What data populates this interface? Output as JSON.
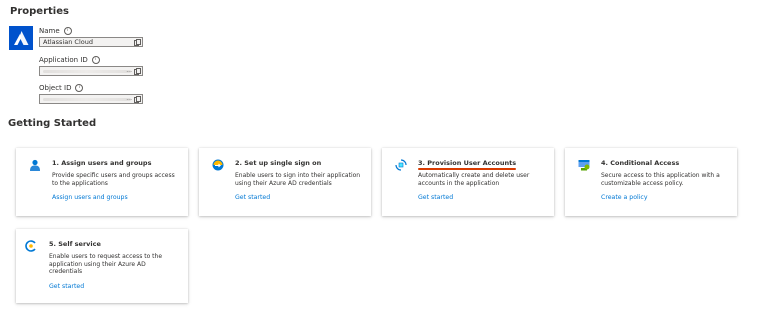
{
  "properties": {
    "title": "Properties",
    "name_label": "Name",
    "name_value": "Atlassian Cloud",
    "app_id_label": "Application ID",
    "app_id_ellipsis": "...",
    "object_id_label": "Object ID",
    "object_id_ellipsis": "..."
  },
  "getting_started": {
    "title": "Getting Started",
    "cards": [
      {
        "title": "1. Assign users and groups",
        "desc": "Provide specific users and groups access to the applications",
        "link": "Assign users and groups",
        "icon": "users-icon"
      },
      {
        "title": "2. Set up single sign on",
        "desc": "Enable users to sign into their application using their Azure AD credentials",
        "link": "Get started",
        "icon": "single-sign-on-icon"
      },
      {
        "title": "3. Provision User Accounts",
        "desc": "Automatically create and delete user accounts in the application",
        "link": "Get started",
        "icon": "provisioning-icon"
      },
      {
        "title": "4. Conditional Access",
        "desc": "Secure access to this application with a customizable access policy.",
        "link": "Create a policy",
        "icon": "conditional-access-icon"
      },
      {
        "title": "5. Self service",
        "desc": "Enable users to request access to the application using their Azure AD credentials",
        "link": "Get started",
        "icon": "self-service-icon"
      }
    ]
  },
  "colors": {
    "link": "#0078d4",
    "highlight_underline": "#d83b01",
    "logo_bg": "#0052cc"
  }
}
